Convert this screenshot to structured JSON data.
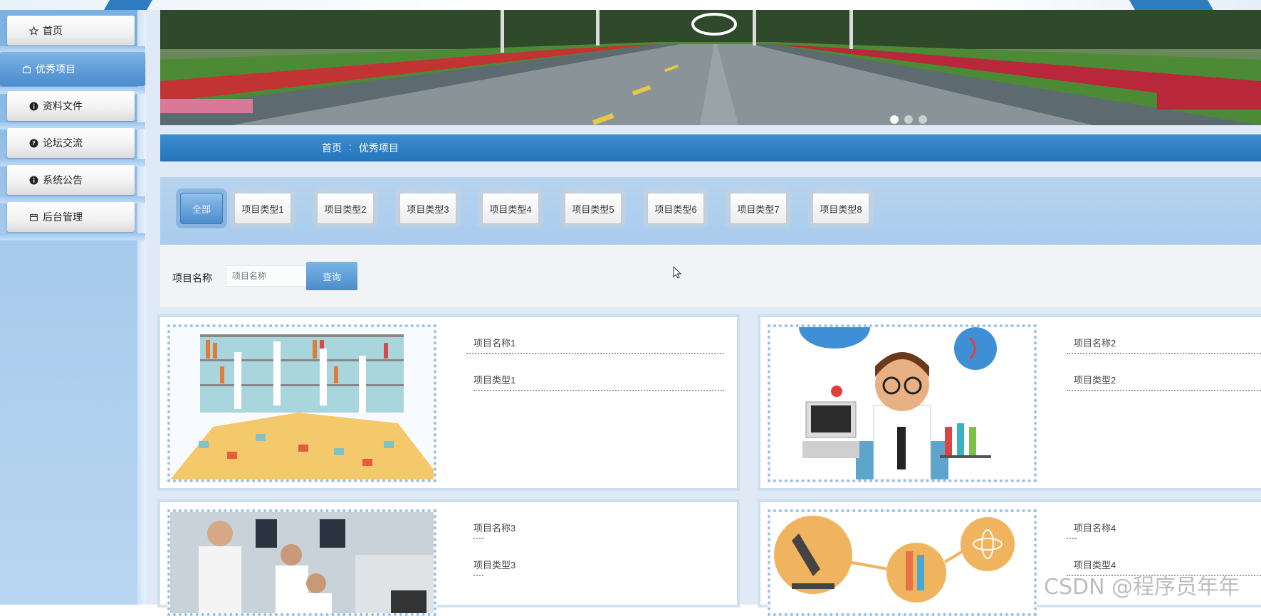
{
  "sidebar": {
    "items": [
      {
        "label": "首页",
        "icon": "star-icon"
      },
      {
        "label": "优秀项目",
        "icon": "bag-icon",
        "active": true
      },
      {
        "label": "资料文件",
        "icon": "info-icon"
      },
      {
        "label": "论坛交流",
        "icon": "question-icon"
      },
      {
        "label": "系统公告",
        "icon": "info-icon"
      },
      {
        "label": "后台管理",
        "icon": "calendar-icon"
      }
    ]
  },
  "banner": {
    "slides": 3,
    "active_slide": 1
  },
  "breadcrumb": {
    "home": "首页",
    "separator": ":",
    "current": "优秀项目"
  },
  "filters": {
    "all_label": "全部",
    "types": [
      "项目类型1",
      "项目类型2",
      "项目类型3",
      "项目类型4",
      "项目类型5",
      "项目类型6",
      "项目类型7",
      "项目类型8"
    ]
  },
  "search": {
    "label": "项目名称",
    "placeholder": "项目名称",
    "button": "查询"
  },
  "cards": [
    {
      "name": "项目名称1",
      "type": "项目类型1"
    },
    {
      "name": "项目名称2",
      "type": "项目类型2"
    },
    {
      "name": "项目名称3",
      "type": "项目类型3"
    },
    {
      "name": "项目名称4",
      "type": "项目类型4"
    }
  ],
  "watermark": "CSDN @程序员年年",
  "colors": {
    "primary": "#2e7bc0",
    "sidebar": "#a7cbec",
    "filter_bg": "#b7d4ef"
  }
}
